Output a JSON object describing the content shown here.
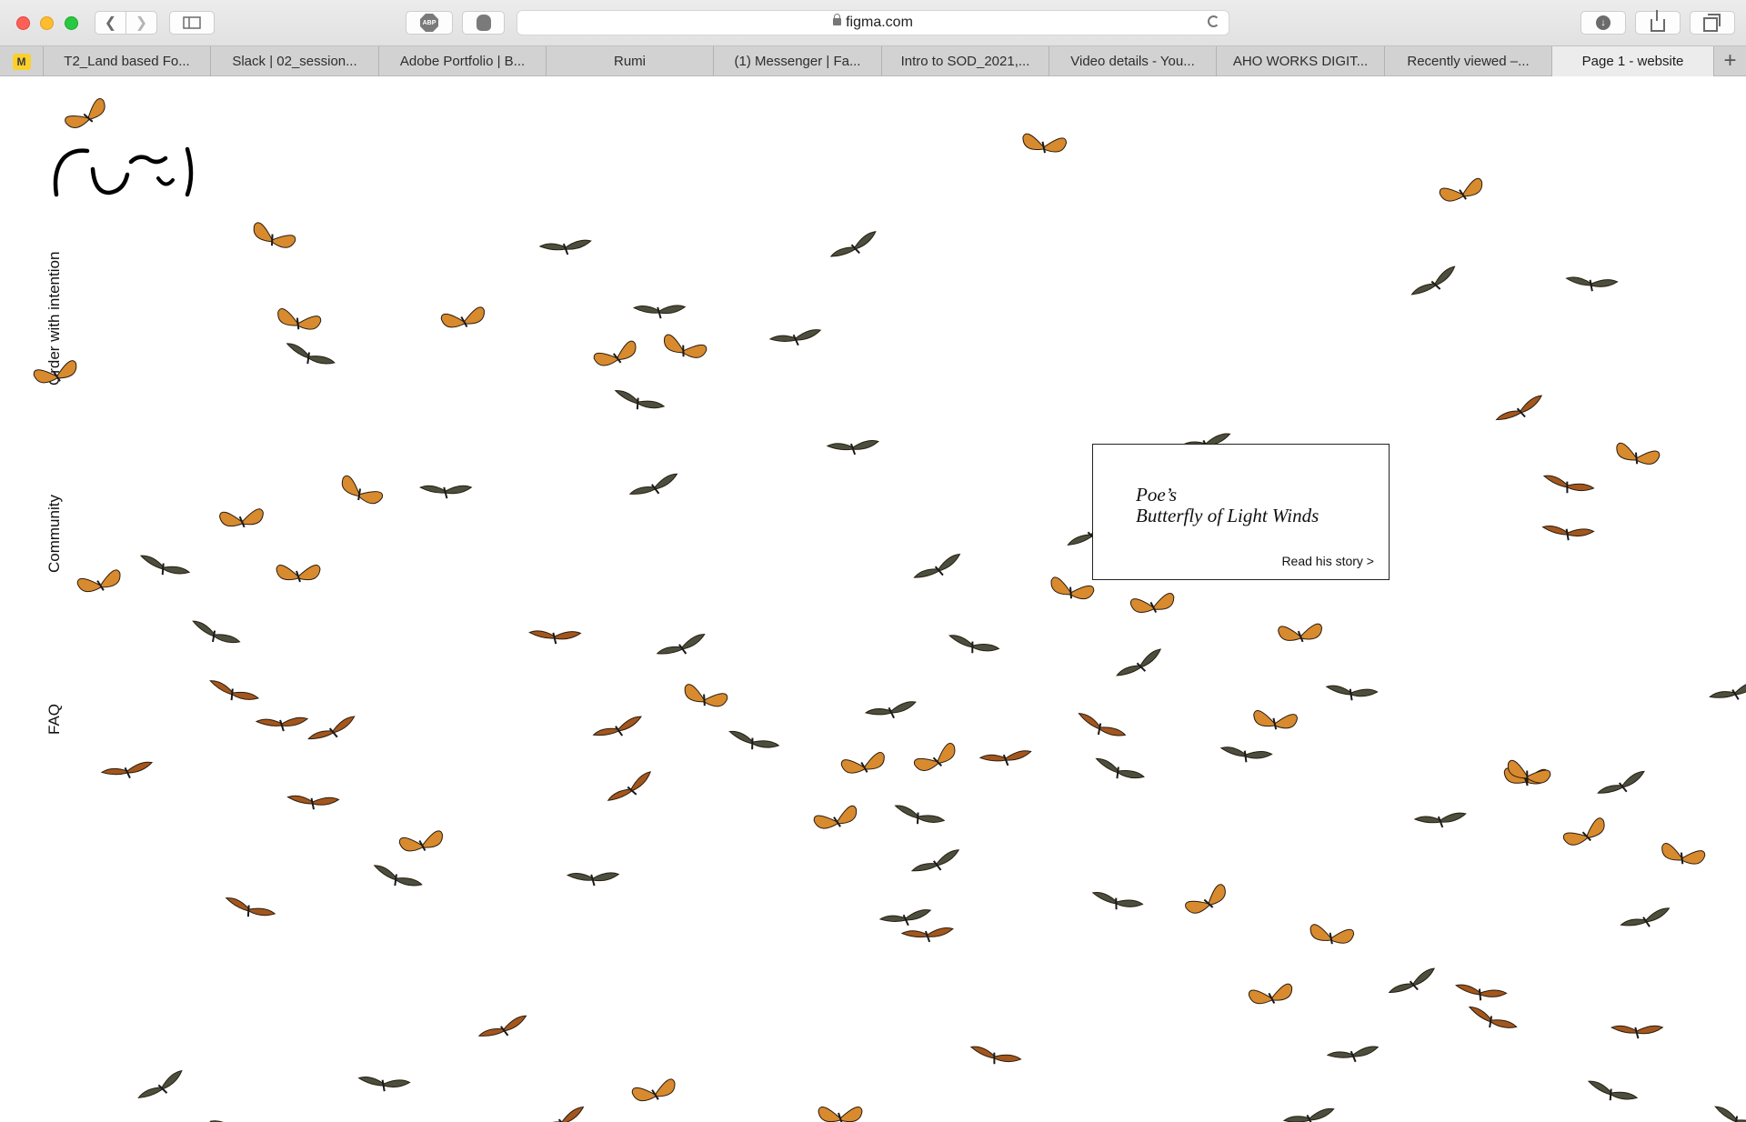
{
  "browser": {
    "url": "figma.com",
    "tabs": [
      {
        "label": "T2_Land based Fo..."
      },
      {
        "label": "Slack | 02_session..."
      },
      {
        "label": "Adobe Portfolio | B..."
      },
      {
        "label": "Rumi"
      },
      {
        "label": "(1) Messenger | Fa..."
      },
      {
        "label": "Intro to SOD_2021,..."
      },
      {
        "label": "Video details - You..."
      },
      {
        "label": "AHO WORKS DIGIT..."
      },
      {
        "label": "Recently viewed –..."
      },
      {
        "label": "Page 1 - website"
      }
    ],
    "active_tab": "Page 1 - website",
    "new_tab_symbol": "+"
  },
  "site": {
    "nav": {
      "order": "Order with intention",
      "community": "Community",
      "faq": "FAQ"
    },
    "story_card": {
      "title_line1": "Poe’s",
      "title_line2": "Butterfly of Light Winds",
      "link": "Read his story >"
    }
  },
  "icons": {
    "back": "chevron-left-icon",
    "forward": "chevron-right-icon",
    "sidebar": "sidebar-icon",
    "adblock": "abp-icon",
    "hand": "hand-icon",
    "lock": "lock-icon",
    "reload": "reload-icon",
    "download": "download-icon",
    "share": "share-icon",
    "tabs": "tabs-overview-icon",
    "abp_text": "ABP"
  },
  "colors": {
    "wing_orange": "#d88a2e",
    "wing_dark": "#4a4f3e",
    "wing_brown": "#a3561d"
  }
}
